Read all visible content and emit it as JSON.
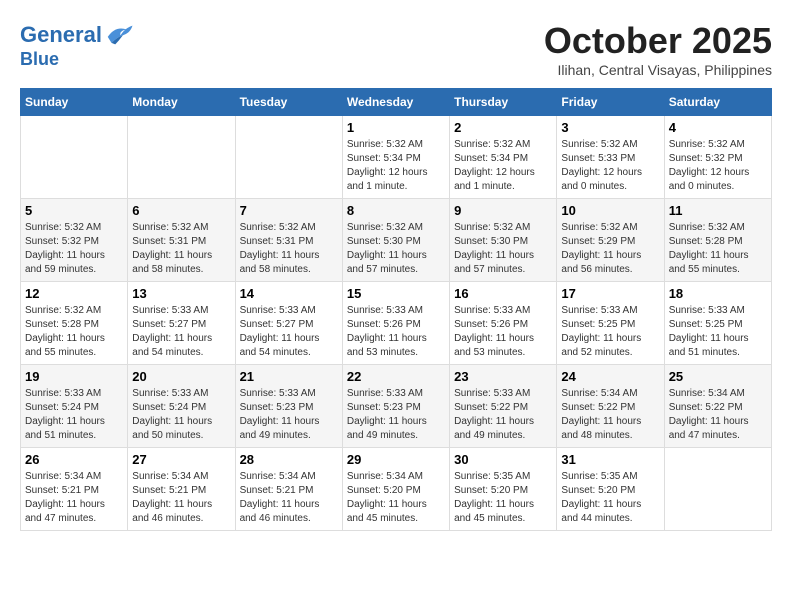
{
  "header": {
    "logo_line1": "General",
    "logo_line2": "Blue",
    "month": "October 2025",
    "location": "Ilihan, Central Visayas, Philippines"
  },
  "weekdays": [
    "Sunday",
    "Monday",
    "Tuesday",
    "Wednesday",
    "Thursday",
    "Friday",
    "Saturday"
  ],
  "weeks": [
    [
      {
        "day": "",
        "sunrise": "",
        "sunset": "",
        "daylight": ""
      },
      {
        "day": "",
        "sunrise": "",
        "sunset": "",
        "daylight": ""
      },
      {
        "day": "",
        "sunrise": "",
        "sunset": "",
        "daylight": ""
      },
      {
        "day": "1",
        "sunrise": "Sunrise: 5:32 AM",
        "sunset": "Sunset: 5:34 PM",
        "daylight": "Daylight: 12 hours and 1 minute."
      },
      {
        "day": "2",
        "sunrise": "Sunrise: 5:32 AM",
        "sunset": "Sunset: 5:34 PM",
        "daylight": "Daylight: 12 hours and 1 minute."
      },
      {
        "day": "3",
        "sunrise": "Sunrise: 5:32 AM",
        "sunset": "Sunset: 5:33 PM",
        "daylight": "Daylight: 12 hours and 0 minutes."
      },
      {
        "day": "4",
        "sunrise": "Sunrise: 5:32 AM",
        "sunset": "Sunset: 5:32 PM",
        "daylight": "Daylight: 12 hours and 0 minutes."
      }
    ],
    [
      {
        "day": "5",
        "sunrise": "Sunrise: 5:32 AM",
        "sunset": "Sunset: 5:32 PM",
        "daylight": "Daylight: 11 hours and 59 minutes."
      },
      {
        "day": "6",
        "sunrise": "Sunrise: 5:32 AM",
        "sunset": "Sunset: 5:31 PM",
        "daylight": "Daylight: 11 hours and 58 minutes."
      },
      {
        "day": "7",
        "sunrise": "Sunrise: 5:32 AM",
        "sunset": "Sunset: 5:31 PM",
        "daylight": "Daylight: 11 hours and 58 minutes."
      },
      {
        "day": "8",
        "sunrise": "Sunrise: 5:32 AM",
        "sunset": "Sunset: 5:30 PM",
        "daylight": "Daylight: 11 hours and 57 minutes."
      },
      {
        "day": "9",
        "sunrise": "Sunrise: 5:32 AM",
        "sunset": "Sunset: 5:30 PM",
        "daylight": "Daylight: 11 hours and 57 minutes."
      },
      {
        "day": "10",
        "sunrise": "Sunrise: 5:32 AM",
        "sunset": "Sunset: 5:29 PM",
        "daylight": "Daylight: 11 hours and 56 minutes."
      },
      {
        "day": "11",
        "sunrise": "Sunrise: 5:32 AM",
        "sunset": "Sunset: 5:28 PM",
        "daylight": "Daylight: 11 hours and 55 minutes."
      }
    ],
    [
      {
        "day": "12",
        "sunrise": "Sunrise: 5:32 AM",
        "sunset": "Sunset: 5:28 PM",
        "daylight": "Daylight: 11 hours and 55 minutes."
      },
      {
        "day": "13",
        "sunrise": "Sunrise: 5:33 AM",
        "sunset": "Sunset: 5:27 PM",
        "daylight": "Daylight: 11 hours and 54 minutes."
      },
      {
        "day": "14",
        "sunrise": "Sunrise: 5:33 AM",
        "sunset": "Sunset: 5:27 PM",
        "daylight": "Daylight: 11 hours and 54 minutes."
      },
      {
        "day": "15",
        "sunrise": "Sunrise: 5:33 AM",
        "sunset": "Sunset: 5:26 PM",
        "daylight": "Daylight: 11 hours and 53 minutes."
      },
      {
        "day": "16",
        "sunrise": "Sunrise: 5:33 AM",
        "sunset": "Sunset: 5:26 PM",
        "daylight": "Daylight: 11 hours and 53 minutes."
      },
      {
        "day": "17",
        "sunrise": "Sunrise: 5:33 AM",
        "sunset": "Sunset: 5:25 PM",
        "daylight": "Daylight: 11 hours and 52 minutes."
      },
      {
        "day": "18",
        "sunrise": "Sunrise: 5:33 AM",
        "sunset": "Sunset: 5:25 PM",
        "daylight": "Daylight: 11 hours and 51 minutes."
      }
    ],
    [
      {
        "day": "19",
        "sunrise": "Sunrise: 5:33 AM",
        "sunset": "Sunset: 5:24 PM",
        "daylight": "Daylight: 11 hours and 51 minutes."
      },
      {
        "day": "20",
        "sunrise": "Sunrise: 5:33 AM",
        "sunset": "Sunset: 5:24 PM",
        "daylight": "Daylight: 11 hours and 50 minutes."
      },
      {
        "day": "21",
        "sunrise": "Sunrise: 5:33 AM",
        "sunset": "Sunset: 5:23 PM",
        "daylight": "Daylight: 11 hours and 49 minutes."
      },
      {
        "day": "22",
        "sunrise": "Sunrise: 5:33 AM",
        "sunset": "Sunset: 5:23 PM",
        "daylight": "Daylight: 11 hours and 49 minutes."
      },
      {
        "day": "23",
        "sunrise": "Sunrise: 5:33 AM",
        "sunset": "Sunset: 5:22 PM",
        "daylight": "Daylight: 11 hours and 49 minutes."
      },
      {
        "day": "24",
        "sunrise": "Sunrise: 5:34 AM",
        "sunset": "Sunset: 5:22 PM",
        "daylight": "Daylight: 11 hours and 48 minutes."
      },
      {
        "day": "25",
        "sunrise": "Sunrise: 5:34 AM",
        "sunset": "Sunset: 5:22 PM",
        "daylight": "Daylight: 11 hours and 47 minutes."
      }
    ],
    [
      {
        "day": "26",
        "sunrise": "Sunrise: 5:34 AM",
        "sunset": "Sunset: 5:21 PM",
        "daylight": "Daylight: 11 hours and 47 minutes."
      },
      {
        "day": "27",
        "sunrise": "Sunrise: 5:34 AM",
        "sunset": "Sunset: 5:21 PM",
        "daylight": "Daylight: 11 hours and 46 minutes."
      },
      {
        "day": "28",
        "sunrise": "Sunrise: 5:34 AM",
        "sunset": "Sunset: 5:21 PM",
        "daylight": "Daylight: 11 hours and 46 minutes."
      },
      {
        "day": "29",
        "sunrise": "Sunrise: 5:34 AM",
        "sunset": "Sunset: 5:20 PM",
        "daylight": "Daylight: 11 hours and 45 minutes."
      },
      {
        "day": "30",
        "sunrise": "Sunrise: 5:35 AM",
        "sunset": "Sunset: 5:20 PM",
        "daylight": "Daylight: 11 hours and 45 minutes."
      },
      {
        "day": "31",
        "sunrise": "Sunrise: 5:35 AM",
        "sunset": "Sunset: 5:20 PM",
        "daylight": "Daylight: 11 hours and 44 minutes."
      },
      {
        "day": "",
        "sunrise": "",
        "sunset": "",
        "daylight": ""
      }
    ]
  ]
}
